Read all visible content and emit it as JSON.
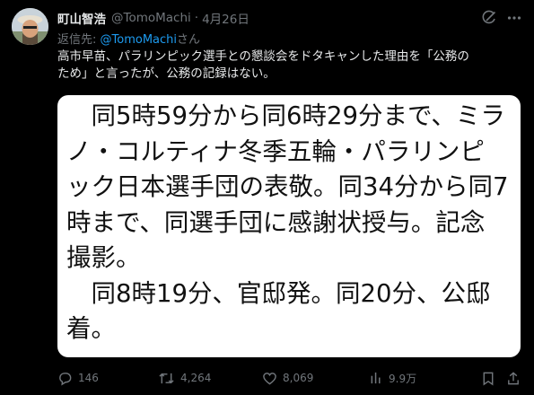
{
  "tweet": {
    "display_name": "町山智浩",
    "handle": "@TomoMachi",
    "separator": "·",
    "date": "4月26日",
    "reply_prefix": "返信先: ",
    "reply_mention": "@TomoMachi",
    "reply_suffix": "さん",
    "text_line1": "高市早苗、パラリンピック選手との懇談会をドタキャンした理由を「公務の",
    "text_line2": "ため」と言ったが、公務の記録はない。"
  },
  "media": {
    "lines": [
      "　同5時59分から同6時29分まで、ミラ",
      "ノ・コルティナ冬季五輪・パラリンピ",
      "ック日本選手団の表敬。同34分から同7",
      "時まで、同選手団に感謝状授与。記念",
      "撮影。",
      "　同8時19分、官邸発。同20分、公邸",
      "着。"
    ]
  },
  "actions": {
    "replies": "146",
    "reposts": "4,264",
    "likes": "8,069",
    "views": "9.9万"
  },
  "icons": [
    "grok-icon",
    "more-icon",
    "reply-icon",
    "repost-icon",
    "like-icon",
    "views-icon",
    "bookmark-icon",
    "share-icon"
  ]
}
